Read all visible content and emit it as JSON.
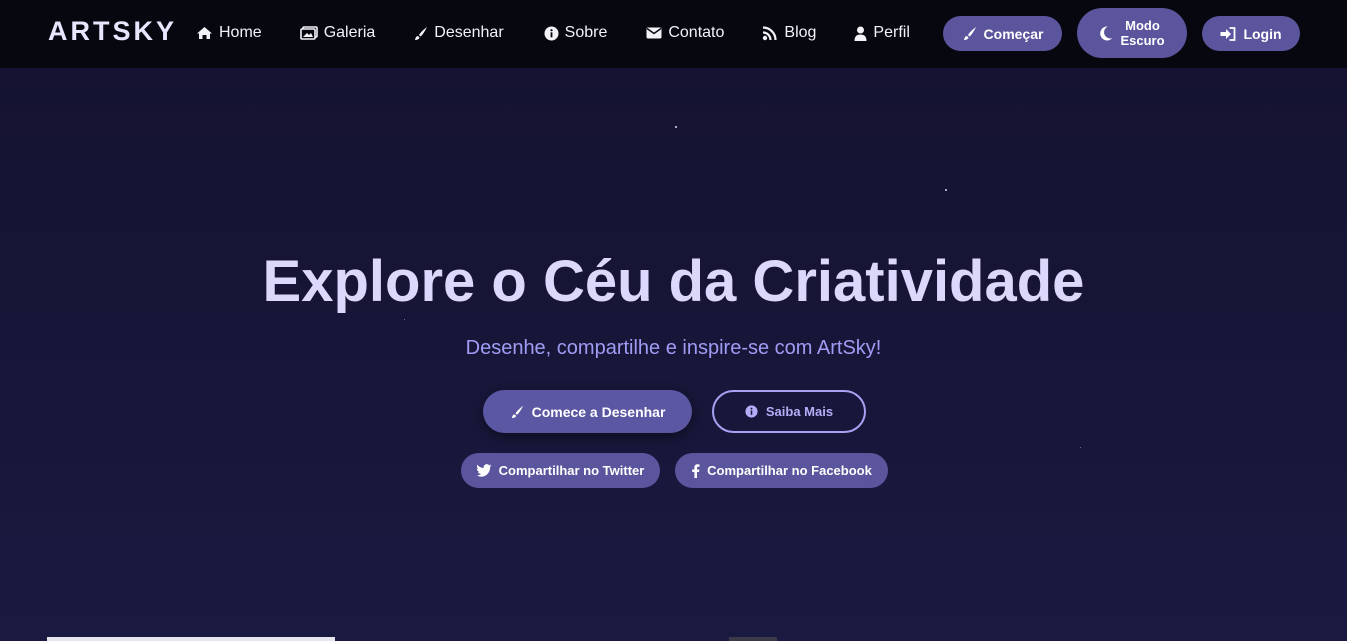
{
  "header": {
    "logo": "ARTSKY",
    "nav": [
      {
        "label": "Home",
        "icon": "home-icon"
      },
      {
        "label": "Galeria",
        "icon": "images-icon"
      },
      {
        "label": "Desenhar",
        "icon": "paint-brush-icon"
      },
      {
        "label": "Sobre",
        "icon": "info-circle-icon"
      },
      {
        "label": "Contato",
        "icon": "envelope-icon"
      },
      {
        "label": "Blog",
        "icon": "rss-icon"
      },
      {
        "label": "Perfil",
        "icon": "user-icon"
      }
    ],
    "buttons": {
      "start": {
        "label": "Começar",
        "icon": "paint-brush-icon"
      },
      "dark_mode": {
        "line1": "Modo",
        "line2": "Escuro",
        "icon": "moon-icon"
      },
      "login": {
        "label": "Login",
        "icon": "sign-in-icon"
      }
    }
  },
  "hero": {
    "title": "Explore o Céu da Criatividade",
    "subtitle": "Desenhe, compartilhe e inspire-se com ArtSky!",
    "primary_cta": {
      "label": "Comece a Desenhar",
      "icon": "paint-brush-icon"
    },
    "secondary_cta": {
      "label": "Saiba Mais",
      "icon": "info-circle-icon"
    },
    "share_twitter": {
      "label": "Compartilhar no Twitter",
      "icon": "twitter-icon"
    },
    "share_facebook": {
      "label": "Compartilhar no Facebook",
      "icon": "facebook-icon"
    }
  },
  "colors": {
    "navbar_bg": "#07070f",
    "hero_bg": "#181738",
    "accent": "#5a559c",
    "title_text": "#dcd8fb",
    "subtitle_text": "#a09cf4"
  }
}
